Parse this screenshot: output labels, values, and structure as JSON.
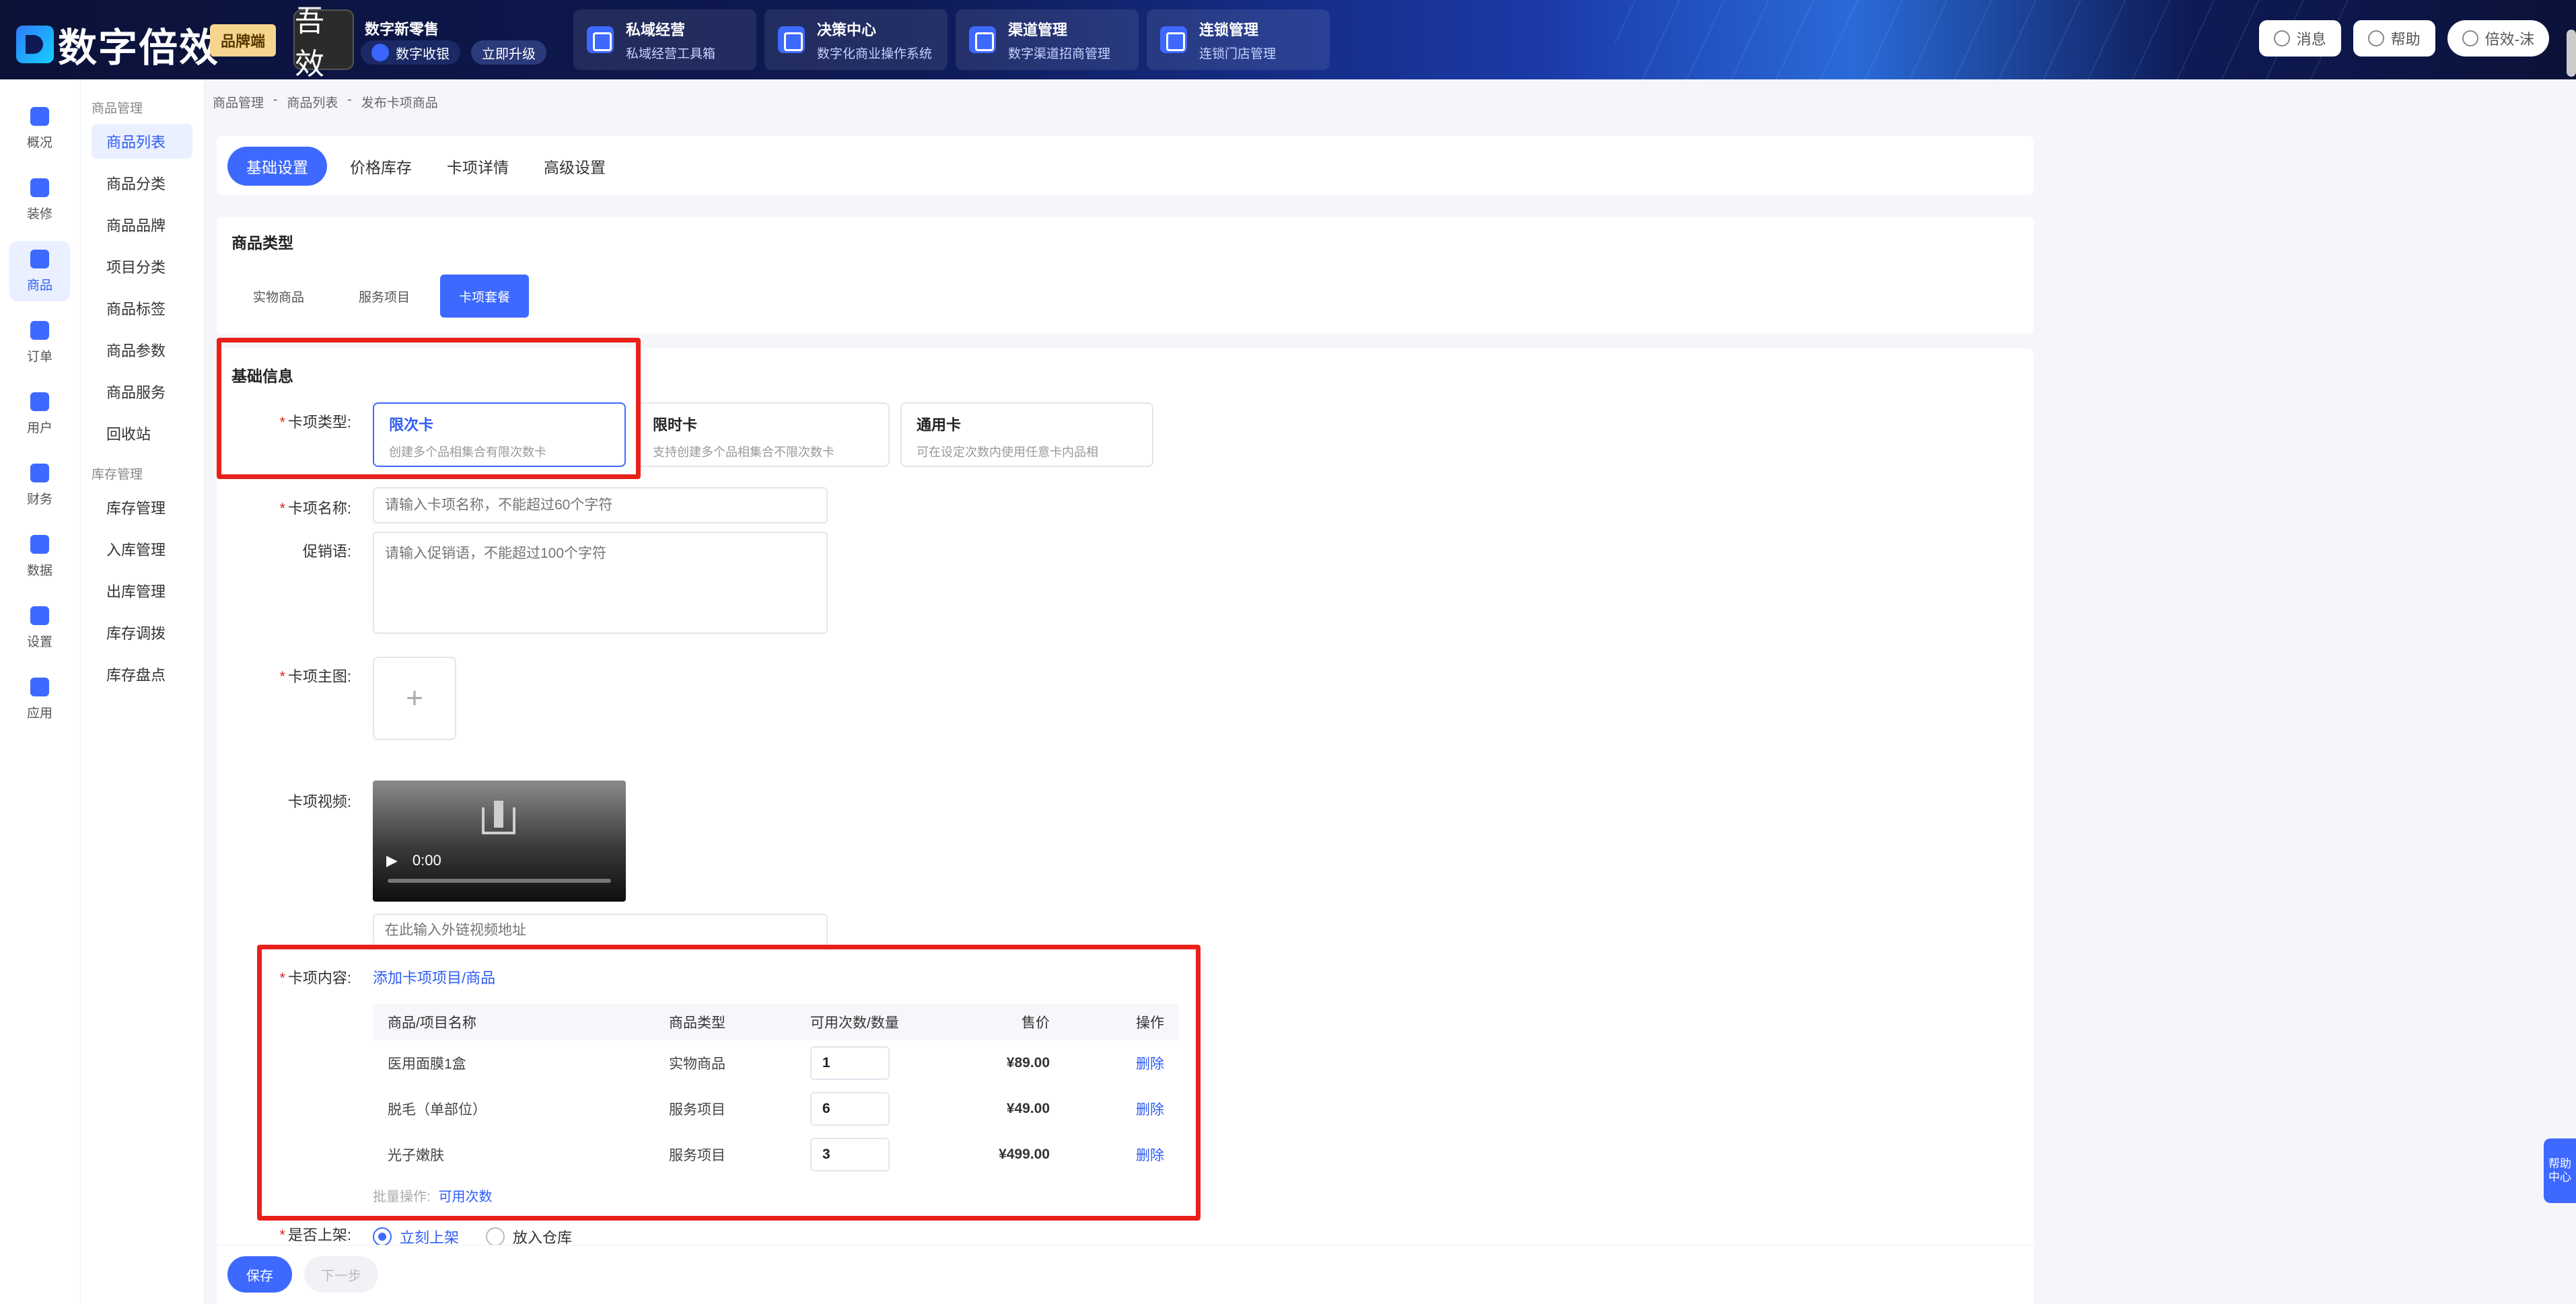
{
  "header": {
    "logo_text": "数字倍效",
    "brand_tag": "品牌端",
    "store_avatar_text": "吾效",
    "store_name": "数字新零售",
    "pill_pay": "数字收银",
    "pill_upgrade": "立即升级",
    "nav_cards": [
      {
        "title": "私域经营",
        "subtitle": "私域经营工具箱"
      },
      {
        "title": "决策中心",
        "subtitle": "数字化商业操作系统"
      },
      {
        "title": "渠道管理",
        "subtitle": "数字渠道招商管理"
      },
      {
        "title": "连锁管理",
        "subtitle": "连锁门店管理"
      }
    ],
    "message_label": "消息",
    "help_label": "帮助",
    "user_label": "倍效-沫"
  },
  "rail": {
    "items": [
      {
        "label": "概况"
      },
      {
        "label": "装修"
      },
      {
        "label": "商品"
      },
      {
        "label": "订单"
      },
      {
        "label": "用户"
      },
      {
        "label": "财务"
      },
      {
        "label": "数据"
      },
      {
        "label": "设置"
      },
      {
        "label": "应用"
      }
    ]
  },
  "subnav": {
    "group1": "商品管理",
    "group1_items": [
      "商品列表",
      "商品分类",
      "商品品牌",
      "项目分类",
      "商品标签",
      "商品参数",
      "商品服务",
      "回收站"
    ],
    "group2": "库存管理",
    "group2_items": [
      "库存管理",
      "入库管理",
      "出库管理",
      "库存调拨",
      "库存盘点"
    ]
  },
  "breadcrumb": [
    "商品管理",
    "-",
    "商品列表",
    "-",
    "发布卡项商品"
  ],
  "tabs": [
    "基础设置",
    "价格库存",
    "卡项详情",
    "高级设置"
  ],
  "product_type": {
    "title": "商品类型",
    "options": [
      "实物商品",
      "服务项目",
      "卡项套餐"
    ]
  },
  "basic_info": {
    "title": "基础信息",
    "card_type_label": "卡项类型:",
    "card_types": [
      {
        "title": "限次卡",
        "desc": "创建多个品相集合有限次数卡"
      },
      {
        "title": "限时卡",
        "desc": "支持创建多个品相集合不限次数卡"
      },
      {
        "title": "通用卡",
        "desc": "可在设定次数内使用任意卡内品相"
      }
    ],
    "name_label": "卡项名称:",
    "name_placeholder": "请输入卡项名称，不能超过60个字符",
    "promo_label": "促销语:",
    "promo_placeholder": "请输入促销语，不能超过100个字符",
    "main_image_label": "卡项主图:",
    "video_label": "卡项视频:",
    "video_time": "0:00",
    "video_url_placeholder": "在此输入外链视频地址",
    "content_label": "卡项内容:",
    "add_item_link": "添加卡项项目/商品",
    "table_headers": [
      "商品/项目名称",
      "商品类型",
      "可用次数/数量",
      "售价",
      "操作"
    ],
    "rows": [
      {
        "name": "医用面膜1盒",
        "type": "实物商品",
        "qty": "1",
        "price": "¥89.00",
        "action": "删除"
      },
      {
        "name": "脱毛（单部位）",
        "type": "服务项目",
        "qty": "6",
        "price": "¥49.00",
        "action": "删除"
      },
      {
        "name": "光子嫩肤",
        "type": "服务项目",
        "qty": "3",
        "price": "¥499.00",
        "action": "删除"
      }
    ],
    "batch_label": "批量操作:",
    "batch_link": "可用次数",
    "shelf_label": "是否上架:",
    "shelf_options": [
      "立刻上架",
      "放入仓库"
    ]
  },
  "footer": {
    "save": "保存",
    "next": "下一步"
  },
  "help_float": "帮助中心"
}
